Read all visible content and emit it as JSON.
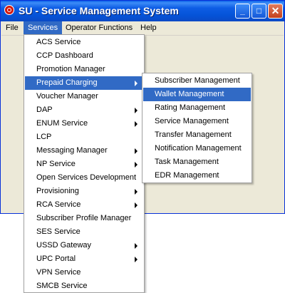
{
  "window": {
    "title": "SU - Service Management System"
  },
  "title_buttons": {
    "minimize": "_",
    "maximize": "□",
    "close": "✕"
  },
  "menubar": {
    "items": [
      "File",
      "Services",
      "Operator Functions",
      "Help"
    ],
    "active": "Services"
  },
  "services_menu": {
    "items": [
      {
        "label": "ACS Service",
        "submenu": false
      },
      {
        "label": "CCP Dashboard",
        "submenu": false
      },
      {
        "label": "Promotion Manager",
        "submenu": false
      },
      {
        "label": "Prepaid Charging",
        "submenu": true,
        "active": true
      },
      {
        "label": "Voucher Manager",
        "submenu": false
      },
      {
        "label": "DAP",
        "submenu": true
      },
      {
        "label": "ENUM Service",
        "submenu": true
      },
      {
        "label": "LCP",
        "submenu": false
      },
      {
        "label": "Messaging Manager",
        "submenu": true
      },
      {
        "label": "NP Service",
        "submenu": true
      },
      {
        "label": "Open Services Development",
        "submenu": false
      },
      {
        "label": "Provisioning",
        "submenu": true
      },
      {
        "label": "RCA Service",
        "submenu": true
      },
      {
        "label": "Subscriber Profile Manager",
        "submenu": false
      },
      {
        "label": "SES Service",
        "submenu": false
      },
      {
        "label": "USSD Gateway",
        "submenu": true
      },
      {
        "label": "UPC Portal",
        "submenu": true
      },
      {
        "label": "VPN Service",
        "submenu": false
      },
      {
        "label": "SMCB Service",
        "submenu": false
      }
    ]
  },
  "prepaid_submenu": {
    "items": [
      {
        "label": "Subscriber Management"
      },
      {
        "label": "Wallet Management",
        "active": true
      },
      {
        "label": "Rating Management"
      },
      {
        "label": "Service Management"
      },
      {
        "label": "Transfer Management"
      },
      {
        "label": "Notification Management"
      },
      {
        "label": "Task Management"
      },
      {
        "label": "EDR Management"
      }
    ]
  },
  "colors": {
    "highlight": "#316ac5",
    "titlebar": "#0a5fe8",
    "window_bg": "#ece9d8"
  }
}
